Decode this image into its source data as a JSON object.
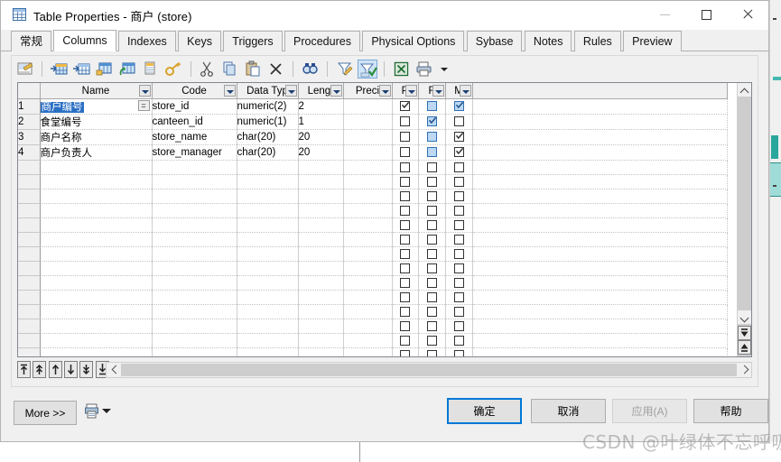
{
  "window": {
    "title": "Table Properties - 商户 (store)",
    "icon": "table-icon",
    "minimize_label": "–",
    "maximize_label": "□",
    "close_label": "✕"
  },
  "tabs": [
    {
      "label": "常规",
      "active": false
    },
    {
      "label": "Columns",
      "active": true
    },
    {
      "label": "Indexes",
      "active": false
    },
    {
      "label": "Keys",
      "active": false
    },
    {
      "label": "Triggers",
      "active": false
    },
    {
      "label": "Procedures",
      "active": false
    },
    {
      "label": "Physical Options",
      "active": false
    },
    {
      "label": "Sybase",
      "active": false
    },
    {
      "label": "Notes",
      "active": false
    },
    {
      "label": "Rules",
      "active": false
    },
    {
      "label": "Preview",
      "active": false
    }
  ],
  "toolbar": {
    "items": [
      {
        "name": "properties-icon",
        "title": "Properties"
      },
      {
        "name": "insert-row-icon",
        "title": "Insert a Row"
      },
      {
        "name": "add-row-icon",
        "title": "Add a Row"
      },
      {
        "name": "add-object-icon",
        "title": "Add Objects"
      },
      {
        "name": "replace-object-icon",
        "title": "Replace Objects"
      },
      {
        "name": "copy-row-icon",
        "title": "Duplicate Row"
      },
      {
        "name": "key-icon",
        "title": "Primary Key"
      },
      {
        "name": "cut-icon",
        "title": "Cut"
      },
      {
        "name": "copy-icon",
        "title": "Copy"
      },
      {
        "name": "paste-icon",
        "title": "Paste"
      },
      {
        "name": "delete-icon",
        "title": "Delete"
      },
      {
        "name": "find-icon",
        "title": "Find"
      },
      {
        "name": "edit-filter-icon",
        "title": "Customize Filter"
      },
      {
        "name": "apply-filter-icon",
        "title": "Apply Filter",
        "pressed": true
      },
      {
        "name": "excel-export-icon",
        "title": "Export to Excel"
      },
      {
        "name": "print-icon",
        "title": "Print"
      }
    ]
  },
  "grid": {
    "columns": [
      {
        "key": "num",
        "label": "",
        "dropdown": false
      },
      {
        "key": "name",
        "label": "Name",
        "dropdown": true
      },
      {
        "key": "code",
        "label": "Code",
        "dropdown": true
      },
      {
        "key": "dtype",
        "label": "Data Typ",
        "dropdown": true
      },
      {
        "key": "len",
        "label": "Lengt",
        "dropdown": true
      },
      {
        "key": "prec",
        "label": "Preci",
        "dropdown": true
      },
      {
        "key": "p",
        "label": "P",
        "dropdown": true
      },
      {
        "key": "f",
        "label": "F",
        "dropdown": true
      },
      {
        "key": "m",
        "label": "M",
        "dropdown": true
      },
      {
        "key": "pad",
        "label": "",
        "dropdown": false
      }
    ],
    "rows": [
      {
        "num": "1",
        "name": "商户编号",
        "name_selected": true,
        "has_eq_button": true,
        "code": "store_id",
        "dtype": "numeric(2)",
        "len": "2",
        "prec": "",
        "p": "checked",
        "f": "selected-empty",
        "m": "selected-checked"
      },
      {
        "num": "2",
        "name": "食堂编号",
        "name_selected": false,
        "has_eq_button": false,
        "code": "canteen_id",
        "dtype": "numeric(1)",
        "len": "1",
        "prec": "",
        "p": "empty",
        "f": "selected-checked",
        "m": "empty"
      },
      {
        "num": "3",
        "name": "商户名称",
        "name_selected": false,
        "has_eq_button": false,
        "code": "store_name",
        "dtype": "char(20)",
        "len": "20",
        "prec": "",
        "p": "empty",
        "f": "selected-empty",
        "m": "checked"
      },
      {
        "num": "4",
        "name": "商户负责人",
        "name_selected": false,
        "has_eq_button": false,
        "code": "store_manager",
        "dtype": "char(20)",
        "len": "20",
        "prec": "",
        "p": "empty",
        "f": "selected-empty",
        "m": "checked"
      }
    ],
    "empty_row_count": 18,
    "selected_cell": "商户编号"
  },
  "row_toolbar": {
    "buttons": [
      {
        "name": "move-to-top-button",
        "glyph": "⭱"
      },
      {
        "name": "move-up-several-button",
        "glyph": "⇑"
      },
      {
        "name": "move-up-button",
        "glyph": "↑"
      },
      {
        "name": "move-down-button",
        "glyph": "↓"
      },
      {
        "name": "move-down-several-button",
        "glyph": "⇓"
      },
      {
        "name": "move-to-bottom-button",
        "glyph": "⭳"
      }
    ]
  },
  "side_nav": {
    "first_row_button": "go-to-first-row",
    "last_row_button": "go-to-last-row"
  },
  "footer": {
    "more_label": "More >>",
    "print_setup_icon": "print-setup-icon",
    "ok_label": "确定",
    "cancel_label": "取消",
    "apply_label": "应用(A)",
    "apply_disabled": true,
    "help_label": "帮助"
  },
  "watermark": {
    "text": "CSDN @叶绿体不忘呼吸"
  },
  "colors": {
    "accent": "#0078d7",
    "selection": "#2b6fc4",
    "checkbox_selected_fill": "#bcd8f2",
    "toolbar_pressed": "#cfe4f7",
    "window_bg": "#f0f0f0"
  }
}
